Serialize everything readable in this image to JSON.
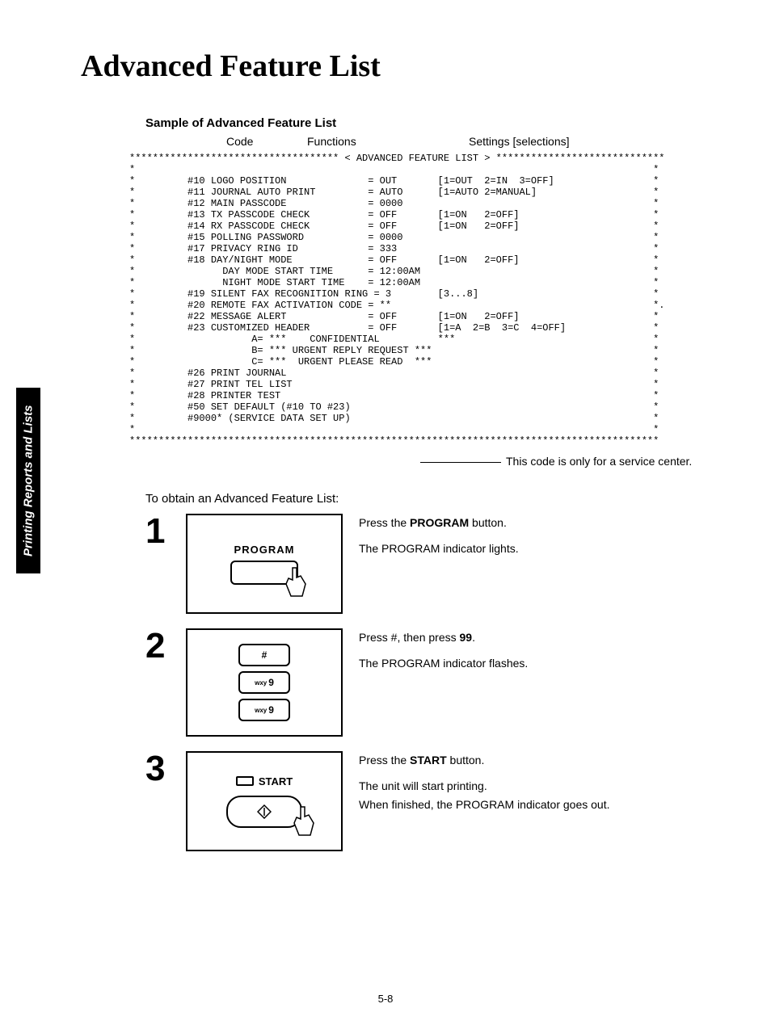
{
  "page": {
    "title": "Advanced Feature List",
    "subtitle": "Sample of Advanced Feature List",
    "columns": {
      "code": "Code",
      "functions": "Functions",
      "settings": "Settings [selections]"
    },
    "side_tab": "Printing Reports and Lists",
    "callout": "This code is only for a service center.",
    "intro": "To obtain an Advanced Feature List:",
    "page_number": "5-8"
  },
  "printout": {
    "lines": [
      "************************************ < ADVANCED FEATURE LIST > *****************************",
      "*                                                                                         *",
      "*         #10 LOGO POSITION              = OUT       [1=OUT  2=IN  3=OFF]                 *",
      "*         #11 JOURNAL AUTO PRINT         = AUTO      [1=AUTO 2=MANUAL]                    *",
      "*         #12 MAIN PASSCODE              = 0000                                           *",
      "*         #13 TX PASSCODE CHECK          = OFF       [1=ON   2=OFF]                       *",
      "*         #14 RX PASSCODE CHECK          = OFF       [1=ON   2=OFF]                       *",
      "*         #15 POLLING PASSWORD           = 0000                                           *",
      "*         #17 PRIVACY RING ID            = 333                                            *",
      "*         #18 DAY/NIGHT MODE             = OFF       [1=ON   2=OFF]                       *",
      "*               DAY MODE START TIME      = 12:00AM                                        *",
      "*               NIGHT MODE START TIME    = 12:00AM                                        *",
      "*         #19 SILENT FAX RECOGNITION RING = 3        [3...8]                              *",
      "*         #20 REMOTE FAX ACTIVATION CODE = **                                             *.",
      "*         #22 MESSAGE ALERT              = OFF       [1=ON   2=OFF]                       *",
      "*         #23 CUSTOMIZED HEADER          = OFF       [1=A  2=B  3=C  4=OFF]               *",
      "*                    A= ***    CONFIDENTIAL          ***                                  *",
      "*                    B= *** URGENT REPLY REQUEST ***                                      *",
      "*                    C= ***  URGENT PLEASE READ  ***                                      *",
      "*         #26 PRINT JOURNAL                                                               *",
      "*         #27 PRINT TEL LIST                                                              *",
      "*         #28 PRINTER TEST                                                                *",
      "*         #50 SET DEFAULT (#10 TO #23)                                                    *",
      "*         #9000* (SERVICE DATA SET UP)                                                    *",
      "*                                                                                         *",
      "*******************************************************************************************"
    ]
  },
  "chart_data": {
    "type": "table",
    "title": "ADVANCED FEATURE LIST",
    "rows": [
      {
        "code": "#10",
        "function": "LOGO POSITION",
        "value": "OUT",
        "options": "1=OUT 2=IN 3=OFF"
      },
      {
        "code": "#11",
        "function": "JOURNAL AUTO PRINT",
        "value": "AUTO",
        "options": "1=AUTO 2=MANUAL"
      },
      {
        "code": "#12",
        "function": "MAIN PASSCODE",
        "value": "0000",
        "options": ""
      },
      {
        "code": "#13",
        "function": "TX PASSCODE CHECK",
        "value": "OFF",
        "options": "1=ON 2=OFF"
      },
      {
        "code": "#14",
        "function": "RX PASSCODE CHECK",
        "value": "OFF",
        "options": "1=ON 2=OFF"
      },
      {
        "code": "#15",
        "function": "POLLING PASSWORD",
        "value": "0000",
        "options": ""
      },
      {
        "code": "#17",
        "function": "PRIVACY RING ID",
        "value": "333",
        "options": ""
      },
      {
        "code": "#18",
        "function": "DAY/NIGHT MODE",
        "value": "OFF",
        "options": "1=ON 2=OFF"
      },
      {
        "code": "",
        "function": "DAY MODE START TIME",
        "value": "12:00AM",
        "options": ""
      },
      {
        "code": "",
        "function": "NIGHT MODE START TIME",
        "value": "12:00AM",
        "options": ""
      },
      {
        "code": "#19",
        "function": "SILENT FAX RECOGNITION RING",
        "value": "3",
        "options": "3...8"
      },
      {
        "code": "#20",
        "function": "REMOTE FAX ACTIVATION CODE",
        "value": "**",
        "options": ""
      },
      {
        "code": "#22",
        "function": "MESSAGE ALERT",
        "value": "OFF",
        "options": "1=ON 2=OFF"
      },
      {
        "code": "#23",
        "function": "CUSTOMIZED HEADER",
        "value": "OFF",
        "options": "1=A 2=B 3=C 4=OFF"
      },
      {
        "code": "",
        "function": "A",
        "value": "*** CONFIDENTIAL ***",
        "options": ""
      },
      {
        "code": "",
        "function": "B",
        "value": "*** URGENT REPLY REQUEST ***",
        "options": ""
      },
      {
        "code": "",
        "function": "C",
        "value": "*** URGENT PLEASE READ ***",
        "options": ""
      },
      {
        "code": "#26",
        "function": "PRINT JOURNAL",
        "value": "",
        "options": ""
      },
      {
        "code": "#27",
        "function": "PRINT TEL LIST",
        "value": "",
        "options": ""
      },
      {
        "code": "#28",
        "function": "PRINTER TEST",
        "value": "",
        "options": ""
      },
      {
        "code": "#50",
        "function": "SET DEFAULT (#10 TO #23)",
        "value": "",
        "options": ""
      },
      {
        "code": "#9000*",
        "function": "(SERVICE DATA SET UP)",
        "value": "",
        "options": ""
      }
    ]
  },
  "steps": [
    {
      "num": "1",
      "button_label": "PROGRAM",
      "lines": [
        "Press the <b>PROGRAM</b> button.",
        "The PROGRAM indicator lights."
      ]
    },
    {
      "num": "2",
      "keys": [
        "#",
        "wxy 9",
        "wxy 9"
      ],
      "lines": [
        "Press #, then press <b>99</b>.",
        "The PROGRAM indicator flashes."
      ]
    },
    {
      "num": "3",
      "button_label": "START",
      "lines": [
        "Press the <b>START</b> button.",
        "The unit will start printing.<br>When finished, the PROGRAM indicator goes out."
      ]
    }
  ]
}
